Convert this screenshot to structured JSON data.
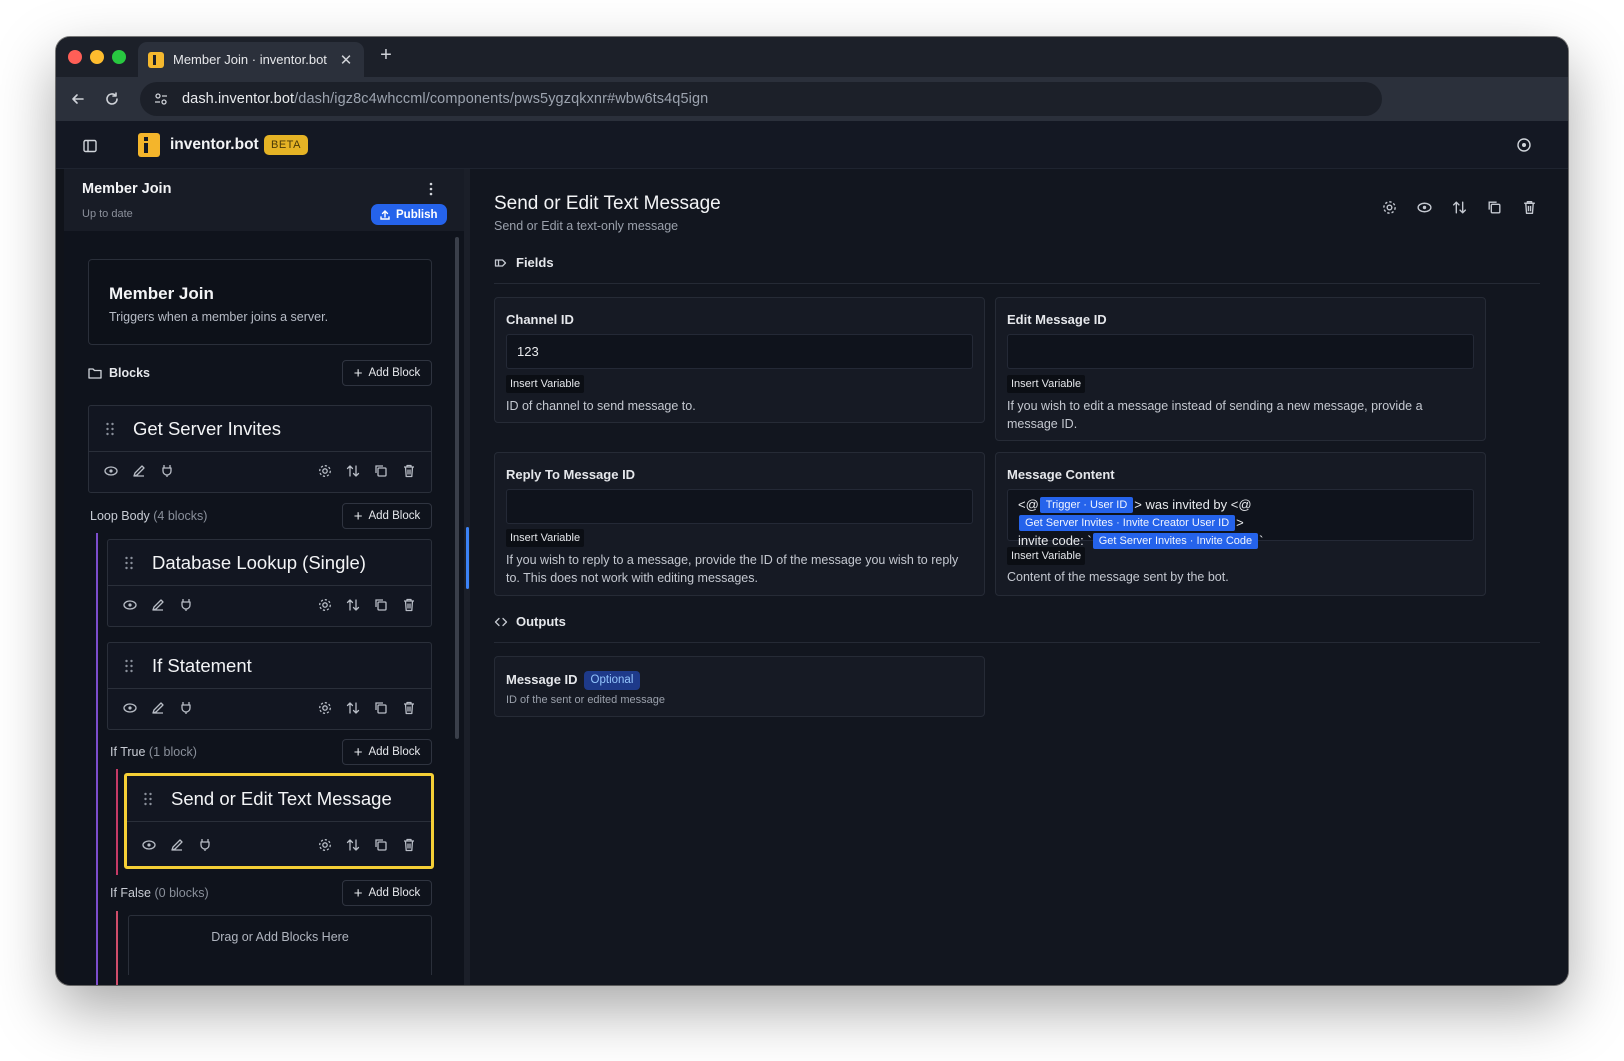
{
  "browser": {
    "tab_title": "Member Join · inventor.bot",
    "url_host": "dash.inventor.bot",
    "url_path": "/dash/igz8c4whccml/components/pws5ygzqkxnr#wbw6ts4q5ign"
  },
  "app": {
    "brand": "inventor.bot",
    "badge": "BETA"
  },
  "left": {
    "title": "Member Join",
    "status": "Up to date",
    "publish_label": "Publish",
    "trigger": {
      "name": "Member Join",
      "description": "Triggers when a member joins a server."
    },
    "blocks_label": "Blocks",
    "add_block_label": "Add Block",
    "block_get_invites": "Get Server Invites",
    "loop_body_label": "Loop Body",
    "loop_body_count": "(4 blocks)",
    "block_db_lookup": "Database Lookup (Single)",
    "block_if": "If Statement",
    "if_true_label": "If True",
    "if_true_count": "(1 block)",
    "block_send_message": "Send or Edit Text Message",
    "if_false_label": "If False",
    "if_false_count": "(0 blocks)",
    "drop_zone": "Drag or Add Blocks Here"
  },
  "right": {
    "title": "Send or Edit Text Message",
    "subtitle": "Send or Edit a text-only message",
    "fields_label": "Fields",
    "insert_variable": "Insert Variable",
    "channel_id": {
      "label": "Channel ID",
      "value": "123",
      "help": "ID of channel to send message to."
    },
    "edit_message_id": {
      "label": "Edit Message ID",
      "value": "",
      "help": "If you wish to edit a message instead of sending a new message, provide a message ID."
    },
    "reply_message_id": {
      "label": "Reply To Message ID",
      "value": "",
      "help": "If you wish to reply to a message, provide the ID of the message you wish to reply to. This does not work with editing messages."
    },
    "message_content": {
      "label": "Message Content",
      "t1": "<@",
      "chip1": "Trigger · User ID",
      "t2": "> was invited by <@",
      "chip2": "Get Server Invites · Invite Creator User ID",
      "t3": ">",
      "t4": "invite code: `",
      "chip3": "Get Server Invites · Invite Code",
      "t5": "`",
      "help": "Content of the message sent by the bot."
    },
    "outputs_label": "Outputs",
    "output_message_id": {
      "label": "Message ID",
      "badge": "Optional",
      "help": "ID of the sent or edited message"
    }
  },
  "colors": {
    "accent_blue": "#2563eb",
    "selected_border": "#f5cf36",
    "brand_yellow": "#f4b52b",
    "loop_line": "#7c4dcc",
    "true_line": "#c53a66",
    "false_line": "#d04d6a"
  }
}
